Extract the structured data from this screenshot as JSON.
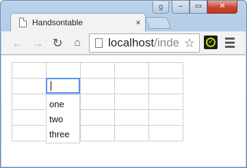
{
  "browser": {
    "tab_title": "Handsontable",
    "tab_close": "×",
    "user_button": "g",
    "caption": {
      "minimize": "‒",
      "maximize": "▭",
      "close": "✕"
    },
    "url_host": "localhost",
    "url_rest": "/inde",
    "icons": {
      "back": "arrow-left-icon",
      "forward": "arrow-right-icon",
      "reload": "reload-icon",
      "home": "home-icon",
      "star": "star-icon",
      "extension": "extension-icon",
      "menu": "hamburger-menu-icon"
    }
  },
  "grid": {
    "rows": 5,
    "cols": 5,
    "editor_value": "",
    "autocomplete_options": [
      "one",
      "two",
      "three"
    ]
  },
  "colors": {
    "selection_border": "#5292f7",
    "cell_border": "#cccccc"
  }
}
